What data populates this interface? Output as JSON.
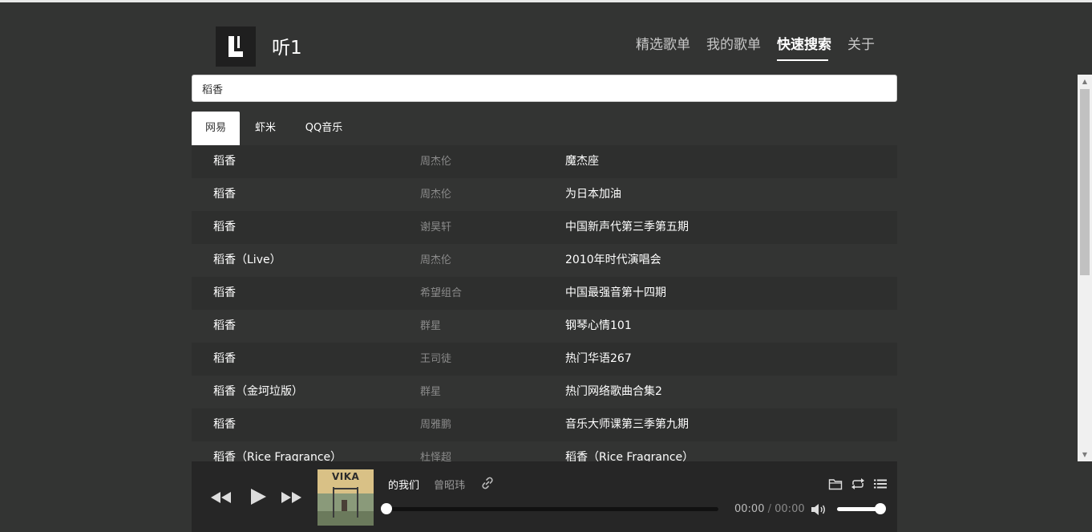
{
  "app": {
    "title": "听1",
    "logo_letter": "L"
  },
  "nav": [
    {
      "label": "精选歌单",
      "active": false
    },
    {
      "label": "我的歌单",
      "active": false
    },
    {
      "label": "快速搜索",
      "active": true
    },
    {
      "label": "关于",
      "active": false
    }
  ],
  "search": {
    "value": "稻香"
  },
  "source_tabs": [
    {
      "label": "网易",
      "active": true
    },
    {
      "label": "虾米",
      "active": false
    },
    {
      "label": "QQ音乐",
      "active": false
    }
  ],
  "results": [
    {
      "title": "稻香",
      "artist": "周杰伦",
      "album": "魔杰座"
    },
    {
      "title": "稻香",
      "artist": "周杰伦",
      "album": "为日本加油"
    },
    {
      "title": "稻香",
      "artist": "谢昊轩",
      "album": "中国新声代第三季第五期"
    },
    {
      "title": "稻香（Live）",
      "artist": "周杰伦",
      "album": "2010年时代演唱会"
    },
    {
      "title": "稻香",
      "artist": "希望组合",
      "album": "中国最强音第十四期"
    },
    {
      "title": "稻香",
      "artist": "群星",
      "album": "钢琴心情101"
    },
    {
      "title": "稻香",
      "artist": "王司徒",
      "album": "热门华语267"
    },
    {
      "title": "稻香（金坷垃版）",
      "artist": "群星",
      "album": "热门网络歌曲合集2"
    },
    {
      "title": "稻香",
      "artist": "周雅鹏",
      "album": "音乐大师课第三季第九期"
    },
    {
      "title": "稻香（Rice Fragrance）",
      "artist": "杜怿超",
      "album": "稻香（Rice Fragrance）"
    }
  ],
  "player": {
    "cover_text": "VIKA",
    "track_title": "的我们",
    "track_artist": "曾昭玮",
    "current_time": "00:00",
    "time_separator": "/",
    "duration": "00:00",
    "progress": 0,
    "volume": 1.0
  },
  "colors": {
    "background": "#333433",
    "row_alt": "#2e2f2e",
    "player_bg": "#262626",
    "logo_bg": "#1f1f1f"
  },
  "icons": {
    "prev": "rewind-icon",
    "play": "play-icon",
    "next": "fast-forward-icon",
    "link": "link-icon",
    "volume": "volume-icon",
    "folder": "folder-icon",
    "repeat": "repeat-icon",
    "playlist": "playlist-icon"
  }
}
